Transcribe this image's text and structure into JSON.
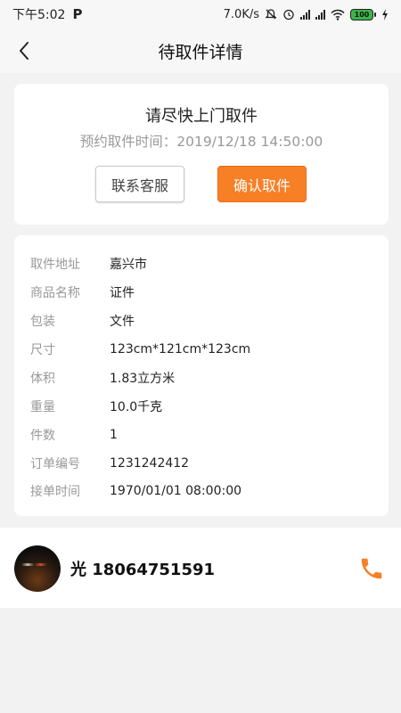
{
  "status_bar": {
    "time": "下午5:02",
    "app_indicator": "P",
    "net_speed": "7.0K/s",
    "battery_level": "100",
    "icons": [
      "mute-bell-icon",
      "alarm-icon",
      "signal-icon",
      "signal-icon",
      "wifi-icon",
      "battery-icon",
      "charging-icon"
    ]
  },
  "nav": {
    "title": "待取件详情",
    "back_icon": "chevron-left-icon"
  },
  "pickup_card": {
    "heading": "请尽快上门取件",
    "appointment_time": "预约取件时间：2019/12/18 14:50:00",
    "contact_button": "联系客服",
    "confirm_button": "确认取件",
    "colors": {
      "confirm_bg": "#f77f26",
      "confirm_text": "#ffffff"
    }
  },
  "info": {
    "rows": [
      {
        "label": "取件地址",
        "value": "嘉兴市"
      },
      {
        "label": "商品名称",
        "value": "证件"
      },
      {
        "label": "包装",
        "value": "文件"
      },
      {
        "label": "尺寸",
        "value": "123cm*121cm*123cm"
      },
      {
        "label": "体积",
        "value": "1.83立方米"
      },
      {
        "label": "重量",
        "value": "10.0千克"
      },
      {
        "label": "件数",
        "value": "1"
      },
      {
        "label": "订单编号",
        "value": "1231242412"
      },
      {
        "label": "接单时间",
        "value": "1970/01/01 08:00:00"
      }
    ]
  },
  "user": {
    "name_phone": "光 18064751591",
    "avatar_icon": "avatar",
    "phone_icon": "phone-icon",
    "accent_color": "#f77f26"
  }
}
